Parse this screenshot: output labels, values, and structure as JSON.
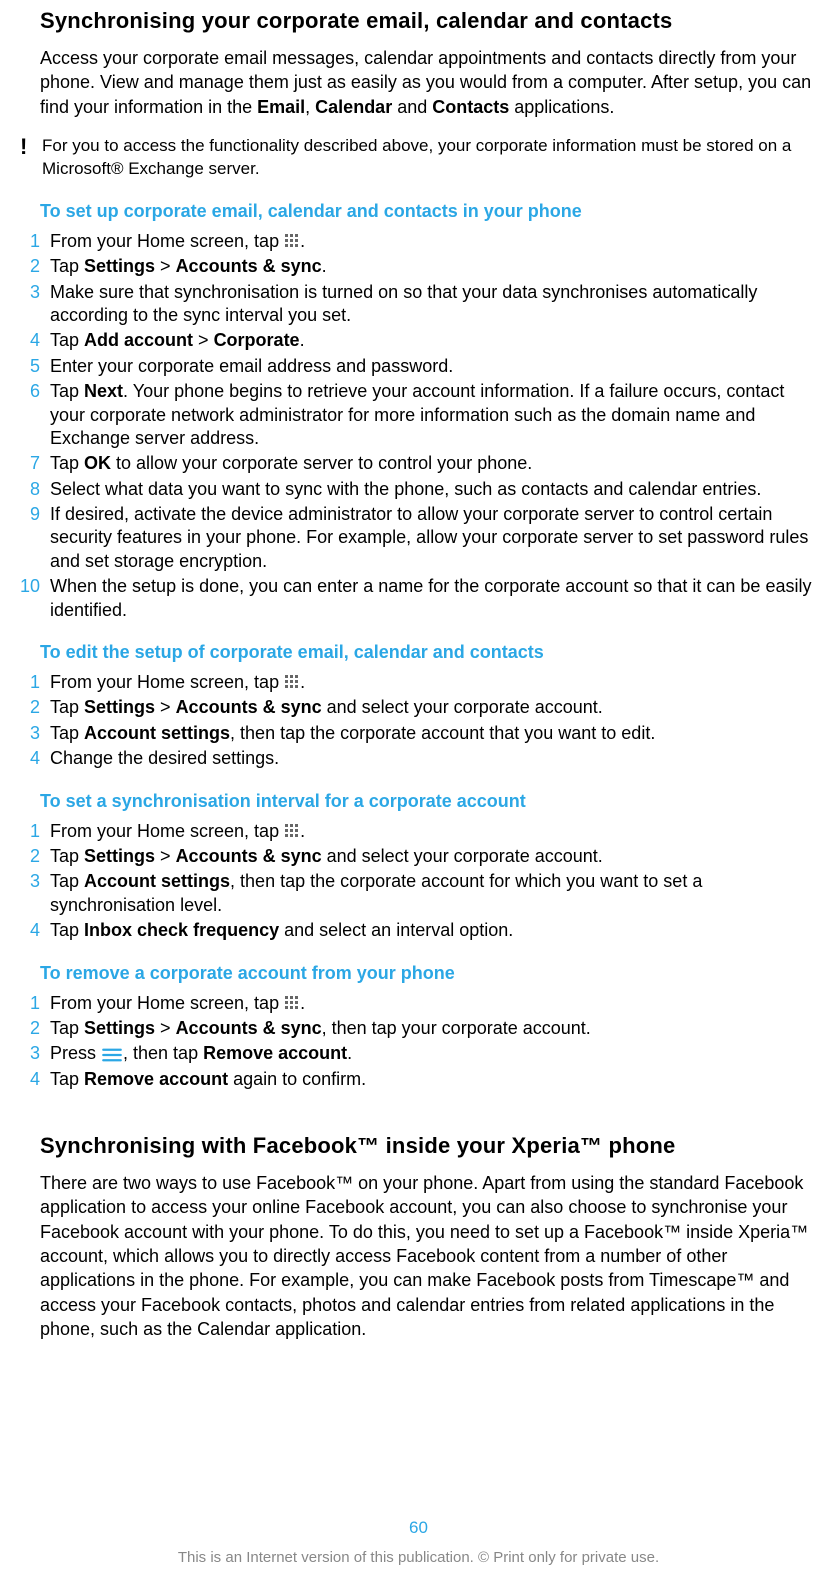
{
  "section1": {
    "title": "Synchronising your corporate email, calendar and contacts",
    "intro_pre": "Access your corporate email messages, calendar appointments and contacts directly from your phone. View and manage them just as easily as you would from a computer. After setup, you can find your information in the ",
    "bold1": "Email",
    "sep1": ", ",
    "bold2": "Calendar",
    "sep2": " and ",
    "bold3": "Contacts",
    "intro_post": " applications.",
    "note": "For you to access the functionality described above, your corporate information must be stored on a Microsoft® Exchange server."
  },
  "sub1": {
    "h": "To set up corporate email, calendar and contacts in your phone",
    "s1_pre": "From your Home screen, tap ",
    "s1_post": ".",
    "s2_pre": "Tap ",
    "s2_b1": "Settings",
    "s2_mid": " > ",
    "s2_b2": "Accounts & sync",
    "s2_post": ".",
    "s3": "Make sure that synchronisation is turned on so that your data synchronises automatically according to the sync interval you set.",
    "s4_pre": "Tap ",
    "s4_b1": "Add account",
    "s4_mid": " > ",
    "s4_b2": "Corporate",
    "s4_post": ".",
    "s5": "Enter your corporate email address and password.",
    "s6_pre": "Tap ",
    "s6_b1": "Next",
    "s6_post": ". Your phone begins to retrieve your account information. If a failure occurs, contact your corporate network administrator for more information such as the domain name and Exchange server address.",
    "s7_pre": "Tap ",
    "s7_b1": "OK",
    "s7_post": " to allow your corporate server to control your phone.",
    "s8": "Select what data you want to sync with the phone, such as contacts and calendar entries.",
    "s9": "If desired, activate the device administrator to allow your corporate server to control certain security features in your phone. For example, allow your corporate server to set password rules and set storage encryption.",
    "s10": "When the setup is done, you can enter a name for the corporate account so that it can be easily identified."
  },
  "sub2": {
    "h": "To edit the setup of corporate email, calendar and contacts",
    "s1_pre": "From your Home screen, tap ",
    "s1_post": ".",
    "s2_pre": "Tap ",
    "s2_b1": "Settings",
    "s2_mid": " > ",
    "s2_b2": "Accounts & sync",
    "s2_post": " and select your corporate account.",
    "s3_pre": "Tap ",
    "s3_b1": "Account settings",
    "s3_post": ", then tap the corporate account that you want to edit.",
    "s4": "Change the desired settings."
  },
  "sub3": {
    "h": "To set a synchronisation interval for a corporate account",
    "s1_pre": "From your Home screen, tap ",
    "s1_post": ".",
    "s2_pre": "Tap ",
    "s2_b1": "Settings",
    "s2_mid": " > ",
    "s2_b2": "Accounts & sync",
    "s2_post": " and select your corporate account.",
    "s3_pre": "Tap ",
    "s3_b1": "Account settings",
    "s3_post": ", then tap the corporate account for which you want to set a synchronisation level.",
    "s4_pre": "Tap ",
    "s4_b1": "Inbox check frequency",
    "s4_post": " and select an interval option."
  },
  "sub4": {
    "h": "To remove a corporate account from your phone",
    "s1_pre": "From your Home screen, tap ",
    "s1_post": ".",
    "s2_pre": "Tap ",
    "s2_b1": "Settings",
    "s2_mid": " > ",
    "s2_b2": "Accounts & sync",
    "s2_post": ", then tap your corporate account.",
    "s3_pre": "Press ",
    "s3_mid": ", then tap ",
    "s3_b1": "Remove account",
    "s3_post": ".",
    "s4_pre": "Tap ",
    "s4_b1": "Remove account",
    "s4_post": " again to confirm."
  },
  "section2": {
    "title": "Synchronising with Facebook™ inside your Xperia™ phone",
    "body": "There are two ways to use Facebook™ on your phone. Apart from using the standard Facebook application to access your online Facebook account, you can also choose to synchronise your Facebook account with your phone. To do this, you need to set up a Facebook™ inside Xperia™ account, which allows you to directly access Facebook content from a number of other applications in the phone. For example, you can make Facebook posts from Timescape™ and access your Facebook contacts, photos and calendar entries from related applications in the phone, such as the Calendar application."
  },
  "page": "60",
  "footer": "This is an Internet version of this publication. © Print only for private use."
}
